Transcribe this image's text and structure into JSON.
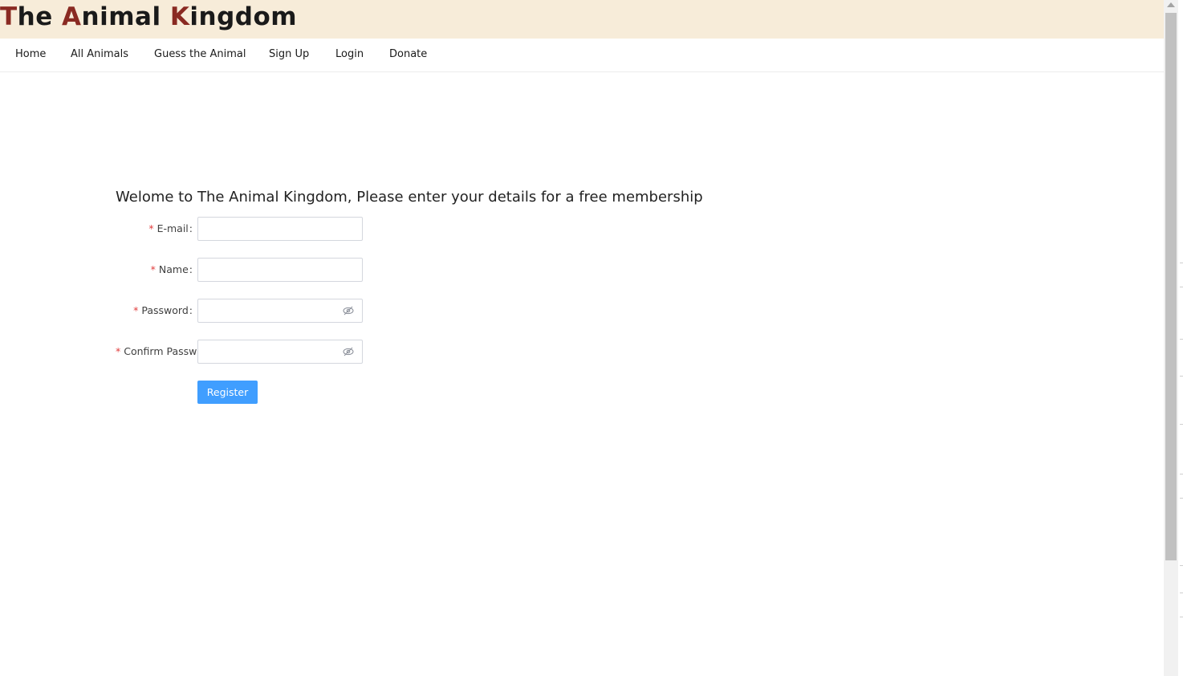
{
  "header": {
    "title_parts": [
      {
        "text": "T",
        "cap": true
      },
      {
        "text": "he ",
        "cap": false
      },
      {
        "text": "A",
        "cap": true
      },
      {
        "text": "nimal ",
        "cap": false
      },
      {
        "text": "K",
        "cap": true
      },
      {
        "text": "ingdom",
        "cap": false
      }
    ],
    "background": "#f7ecd9",
    "accent": "#8a2a22"
  },
  "nav": {
    "items": [
      {
        "label": "Home"
      },
      {
        "label": "All Animals"
      },
      {
        "label": "Guess the Animal"
      },
      {
        "label": "Sign Up"
      },
      {
        "label": "Login"
      },
      {
        "label": "Donate"
      }
    ]
  },
  "form": {
    "title": "Welome to The Animal Kingdom, Please enter your details for a free membership",
    "required_marker": "*",
    "colon": ":",
    "fields": [
      {
        "label": "E-mail",
        "value": ""
      },
      {
        "label": "Name",
        "value": ""
      },
      {
        "label": "Password",
        "value": "",
        "icon": "eye-off-icon"
      },
      {
        "label": "Confirm Password",
        "value": "",
        "icon": "eye-off-icon"
      }
    ],
    "register_label": "Register",
    "button_color": "#409eff",
    "required_color": "#e03c3c"
  }
}
